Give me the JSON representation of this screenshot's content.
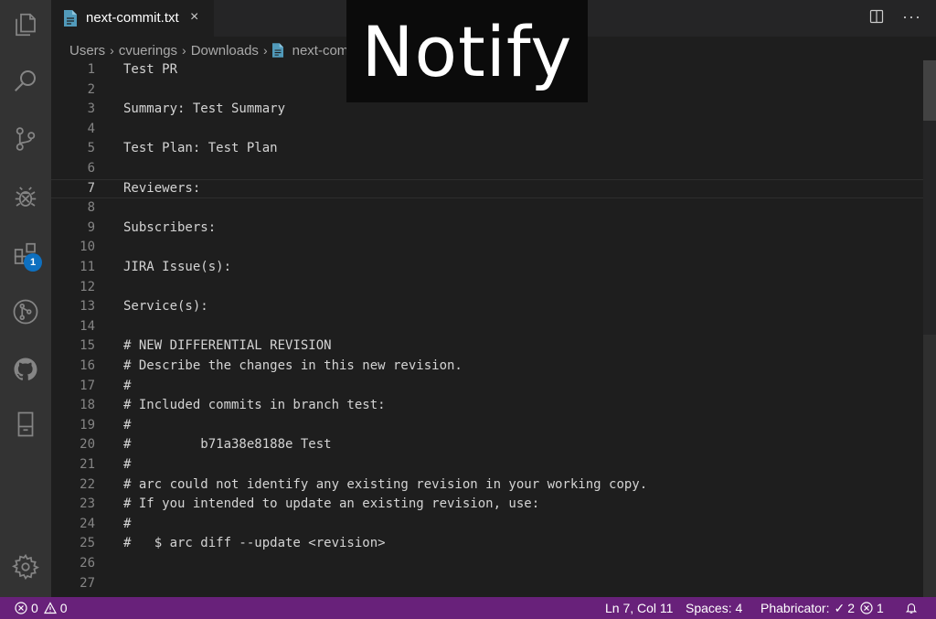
{
  "tab": {
    "filename": "next-commit.txt",
    "close_glyph": "×",
    "more_glyph": "···"
  },
  "breadcrumb": {
    "items": [
      "Users",
      "cvuerings",
      "Downloads",
      "next-commit.txt"
    ],
    "separator": "›"
  },
  "editor": {
    "lines": [
      {
        "n": "1",
        "text": "Test PR"
      },
      {
        "n": "2",
        "text": ""
      },
      {
        "n": "3",
        "text": "Summary: Test Summary"
      },
      {
        "n": "4",
        "text": ""
      },
      {
        "n": "5",
        "text": "Test Plan: Test Plan"
      },
      {
        "n": "6",
        "text": ""
      },
      {
        "n": "7",
        "text": "Reviewers:"
      },
      {
        "n": "8",
        "text": ""
      },
      {
        "n": "9",
        "text": "Subscribers:"
      },
      {
        "n": "10",
        "text": ""
      },
      {
        "n": "11",
        "text": "JIRA Issue(s):"
      },
      {
        "n": "12",
        "text": ""
      },
      {
        "n": "13",
        "text": "Service(s):"
      },
      {
        "n": "14",
        "text": ""
      },
      {
        "n": "15",
        "text": "# NEW DIFFERENTIAL REVISION"
      },
      {
        "n": "16",
        "text": "# Describe the changes in this new revision."
      },
      {
        "n": "17",
        "text": "#"
      },
      {
        "n": "18",
        "text": "# Included commits in branch test:"
      },
      {
        "n": "19",
        "text": "#"
      },
      {
        "n": "20",
        "text": "#         b71a38e8188e Test"
      },
      {
        "n": "21",
        "text": "#"
      },
      {
        "n": "22",
        "text": "# arc could not identify any existing revision in your working copy."
      },
      {
        "n": "23",
        "text": "# If you intended to update an existing revision, use:"
      },
      {
        "n": "24",
        "text": "#"
      },
      {
        "n": "25",
        "text": "#   $ arc diff --update <revision>"
      },
      {
        "n": "26",
        "text": ""
      },
      {
        "n": "27",
        "text": ""
      }
    ],
    "current_line": 7
  },
  "activity_bar": {
    "icons": [
      "explorer-icon",
      "search-icon",
      "source-control-icon",
      "debug-icon",
      "extensions-icon",
      "pull-request-icon",
      "github-icon",
      "notebook-icon",
      "settings-gear-icon"
    ],
    "extensions_badge": "1"
  },
  "overlay": {
    "text": "Notify"
  },
  "status_bar": {
    "errors": "0",
    "warnings": "0",
    "cursor_position": "Ln 7, Col 11",
    "indentation": "Spaces: 4",
    "phabricator_label": "Phabricator:",
    "phabricator_checks": "2",
    "phabricator_errors": "1",
    "background_color": "#68217a"
  },
  "colors": {
    "editor_bg": "#1e1e1e",
    "activity_bar_bg": "#333333",
    "tab_bar_bg": "#252526",
    "badge": "#0e70c0",
    "file_icon": "#519aba"
  }
}
